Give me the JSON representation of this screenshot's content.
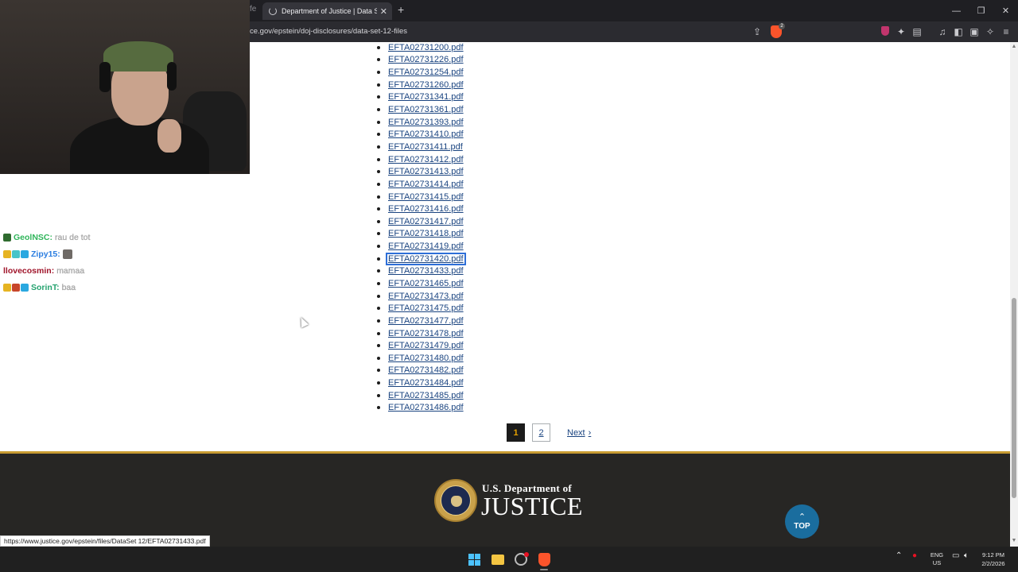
{
  "browser": {
    "prev_tab_fragment": "fe",
    "tab_title": "Department of Justice | Data Set",
    "url_fragment": "ce.gov/epstein/doj-disclosures/data-set-12-files",
    "brave_badge": "2"
  },
  "chat": {
    "messages": [
      {
        "user": "GeolNSC:",
        "message": "rau de tot",
        "user_color": "#2fb55a"
      },
      {
        "user": "Zipy15:",
        "message": "",
        "user_color": "#2a7de0"
      },
      {
        "user": "llovecosmin:",
        "message": "mamaa",
        "user_color": "#a0142a"
      },
      {
        "user": "SorinT:",
        "message": "baa",
        "user_color": "#25a36f"
      }
    ]
  },
  "files": [
    "EFTA02731200.pdf",
    "EFTA02731226.pdf",
    "EFTA02731254.pdf",
    "EFTA02731260.pdf",
    "EFTA02731341.pdf",
    "EFTA02731361.pdf",
    "EFTA02731393.pdf",
    "EFTA02731410.pdf",
    "EFTA02731411.pdf",
    "EFTA02731412.pdf",
    "EFTA02731413.pdf",
    "EFTA02731414.pdf",
    "EFTA02731415.pdf",
    "EFTA02731416.pdf",
    "EFTA02731417.pdf",
    "EFTA02731418.pdf",
    "EFTA02731419.pdf",
    "EFTA02731420.pdf",
    "EFTA02731433.pdf",
    "EFTA02731465.pdf",
    "EFTA02731473.pdf",
    "EFTA02731475.pdf",
    "EFTA02731477.pdf",
    "EFTA02731478.pdf",
    "EFTA02731479.pdf",
    "EFTA02731480.pdf",
    "EFTA02731482.pdf",
    "EFTA02731484.pdf",
    "EFTA02731485.pdf",
    "EFTA02731486.pdf"
  ],
  "focused_file": "EFTA02731420.pdf",
  "pagination": {
    "current": "1",
    "other": "2",
    "next_label": "Next",
    "next_chevron": "›"
  },
  "footer": {
    "line1": "U.S. Department of",
    "line2": "JUSTICE",
    "top_label": "TOP",
    "top_chevron": "⌃"
  },
  "status_url": "https://www.justice.gov/epstein/files/DataSet 12/EFTA02731433.pdf",
  "taskbar": {
    "lang_line1": "ENG",
    "lang_line2": "US",
    "time": "9:12 PM",
    "date": "2/2/2026"
  },
  "colors": {
    "link": "#1a4480",
    "footer_bg": "#272624",
    "footer_accent": "#c79b32",
    "top_button": "#1a6d9e",
    "current_page_text": "#e5a000"
  },
  "icons": [
    "share-icon",
    "brave-shield-icon",
    "extensions-icon",
    "reading-list-icon",
    "media-icon",
    "sidebar-icon",
    "wallet-icon",
    "leo-ai-icon",
    "menu-icon"
  ]
}
